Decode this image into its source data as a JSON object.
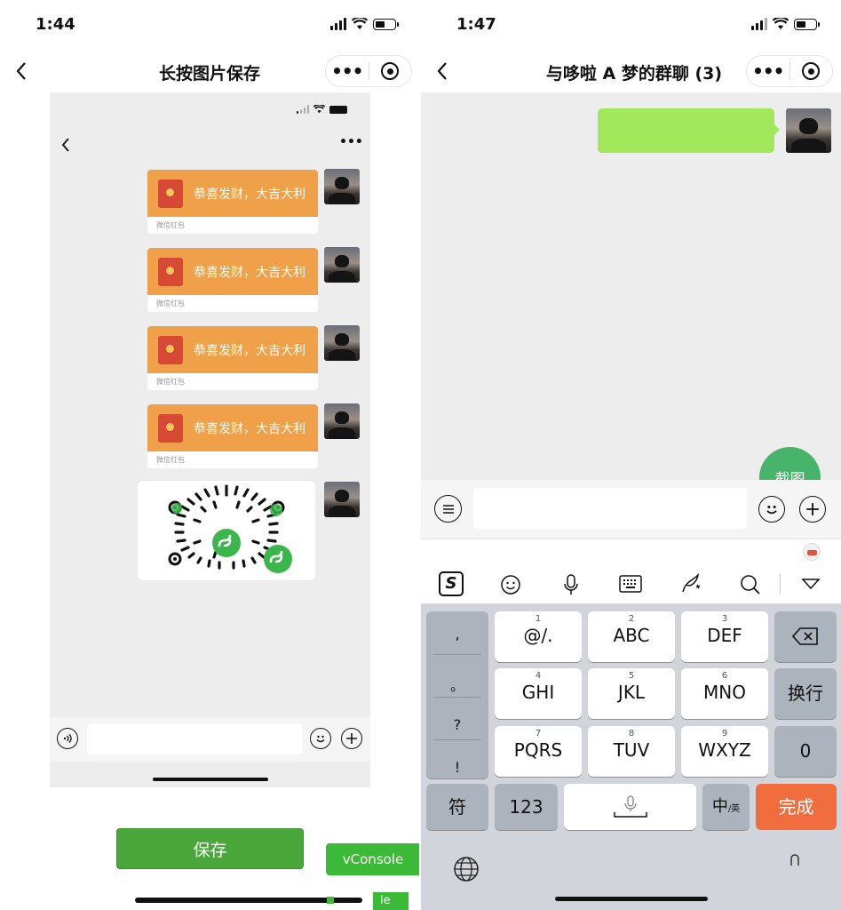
{
  "left": {
    "status": {
      "time": "1:44"
    },
    "nav": {
      "title": "长按图片保存"
    },
    "inner_chat": {
      "red_packets": [
        {
          "text": "恭喜发财，大吉大利",
          "label": "微信红包"
        },
        {
          "text": "恭喜发财，大吉大利",
          "label": "微信红包"
        },
        {
          "text": "恭喜发财，大吉大利",
          "label": "微信红包"
        },
        {
          "text": "恭喜发财，大吉大利",
          "label": "微信红包"
        }
      ]
    },
    "save_button": "保存",
    "vconsole": "vConsole",
    "partial_badge": "le"
  },
  "right": {
    "status": {
      "time": "1:47"
    },
    "nav": {
      "title": "与哆啦 A 梦的群聊 (3)"
    },
    "screenshot_fab": "截图",
    "keyboard": {
      "side_punct": [
        ",",
        "。",
        "?",
        "!"
      ],
      "keys": [
        {
          "num": "1",
          "label": "@/."
        },
        {
          "num": "2",
          "label": "ABC"
        },
        {
          "num": "3",
          "label": "DEF"
        },
        {
          "num": "4",
          "label": "GHI"
        },
        {
          "num": "5",
          "label": "JKL"
        },
        {
          "num": "6",
          "label": "MNO"
        },
        {
          "num": "7",
          "label": "PQRS"
        },
        {
          "num": "8",
          "label": "TUV"
        },
        {
          "num": "9",
          "label": "WXYZ"
        }
      ],
      "newline": "换行",
      "zero": "0",
      "symbols": "符",
      "num_switch": "123",
      "lang_main": "中",
      "lang_sub": "/英",
      "done": "完成"
    }
  },
  "colors": {
    "wechat_green": "#4aa83a",
    "red_packet_orange": "#f0a049",
    "bubble_green": "#a0e75a",
    "done_orange": "#f26d3d",
    "fab_green": "#48b36b"
  }
}
